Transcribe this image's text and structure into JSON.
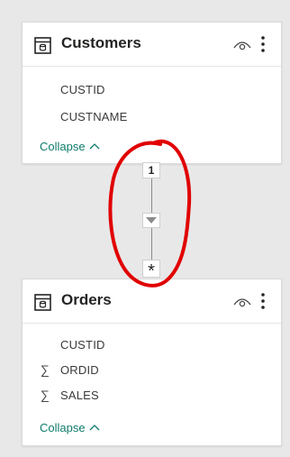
{
  "theme": {
    "background": "#e8e8e8",
    "card_bg": "#ffffff",
    "link_color": "#0e7c6b",
    "annotation_color": "#e10000"
  },
  "customers": {
    "title": "Customers",
    "icon": "table-icon",
    "fields": [
      {
        "name": "CUSTID",
        "aggregate": false
      },
      {
        "name": "CUSTNAME",
        "aggregate": false
      }
    ],
    "collapse_label": "Collapse"
  },
  "orders": {
    "title": "Orders",
    "icon": "table-icon",
    "fields": [
      {
        "name": "CUSTID",
        "aggregate": false
      },
      {
        "name": "ORDID",
        "aggregate": true,
        "symbol": "∑"
      },
      {
        "name": "SALES",
        "aggregate": true,
        "symbol": "∑"
      }
    ],
    "collapse_label": "Collapse"
  },
  "relationship": {
    "one_side": "1",
    "many_side": "*",
    "filter_direction": "single"
  }
}
